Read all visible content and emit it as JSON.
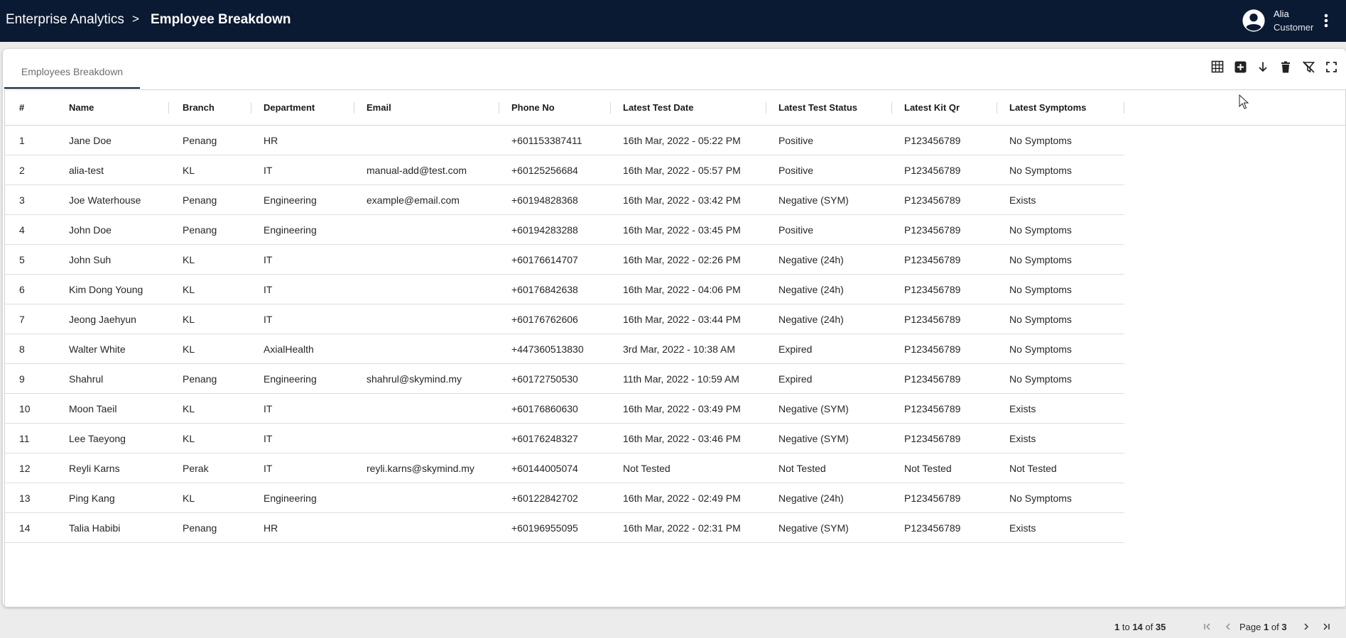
{
  "header": {
    "breadcrumb_root": "Enterprise Analytics",
    "breadcrumb_separator": ">",
    "page_title": "Employee Breakdown",
    "user": {
      "name": "Alia",
      "role": "Customer"
    }
  },
  "tabs": [
    {
      "label": "Employees Breakdown",
      "active": true
    }
  ],
  "toolbar": {
    "icons": [
      "table-grid-icon",
      "add-box-icon",
      "arrow-down-icon",
      "trash-icon",
      "clear-filter-icon",
      "fullscreen-icon"
    ]
  },
  "table": {
    "columns": [
      "#",
      "Name",
      "Branch",
      "Department",
      "Email",
      "Phone No",
      "Latest Test Date",
      "Latest Test Status",
      "Latest Kit Qr",
      "Latest Symptoms"
    ],
    "rows": [
      [
        "1",
        "Jane Doe",
        "Penang",
        "HR",
        "",
        "+601153387411",
        "16th Mar, 2022 - 05:22 PM",
        "Positive",
        "P123456789",
        "No Symptoms"
      ],
      [
        "2",
        "alia-test",
        "KL",
        "IT",
        "manual-add@test.com",
        "+60125256684",
        "16th Mar, 2022 - 05:57 PM",
        "Positive",
        "P123456789",
        "No Symptoms"
      ],
      [
        "3",
        "Joe Waterhouse",
        "Penang",
        "Engineering",
        "example@email.com",
        "+60194828368",
        "16th Mar, 2022 - 03:42 PM",
        "Negative (SYM)",
        "P123456789",
        "Exists"
      ],
      [
        "4",
        "John Doe",
        "Penang",
        "Engineering",
        "",
        "+60194283288",
        "16th Mar, 2022 - 03:45 PM",
        "Positive",
        "P123456789",
        "No Symptoms"
      ],
      [
        "5",
        "John Suh",
        "KL",
        "IT",
        "",
        "+60176614707",
        "16th Mar, 2022 - 02:26 PM",
        "Negative (24h)",
        "P123456789",
        "No Symptoms"
      ],
      [
        "6",
        "Kim Dong Young",
        "KL",
        "IT",
        "",
        "+60176842638",
        "16th Mar, 2022 - 04:06 PM",
        "Negative (24h)",
        "P123456789",
        "No Symptoms"
      ],
      [
        "7",
        "Jeong Jaehyun",
        "KL",
        "IT",
        "",
        "+60176762606",
        "16th Mar, 2022 - 03:44 PM",
        "Negative (24h)",
        "P123456789",
        "No Symptoms"
      ],
      [
        "8",
        "Walter White",
        "KL",
        "AxialHealth",
        "",
        "+447360513830",
        "3rd Mar, 2022 - 10:38 AM",
        "Expired",
        "P123456789",
        "No Symptoms"
      ],
      [
        "9",
        "Shahrul",
        "Penang",
        "Engineering",
        "shahrul@skymind.my",
        "+60172750530",
        "11th Mar, 2022 - 10:59 AM",
        "Expired",
        "P123456789",
        "No Symptoms"
      ],
      [
        "10",
        "Moon Taeil",
        "KL",
        "IT",
        "",
        "+60176860630",
        "16th Mar, 2022 - 03:49 PM",
        "Negative (SYM)",
        "P123456789",
        "Exists"
      ],
      [
        "11",
        "Lee Taeyong",
        "KL",
        "IT",
        "",
        "+60176248327",
        "16th Mar, 2022 - 03:46 PM",
        "Negative (SYM)",
        "P123456789",
        "Exists"
      ],
      [
        "12",
        "Reyli Karns",
        "Perak",
        "IT",
        "reyli.karns@skymind.my",
        "+60144005074",
        "Not Tested",
        "Not Tested",
        "Not Tested",
        "Not Tested"
      ],
      [
        "13",
        "Ping Kang",
        "KL",
        "Engineering",
        "",
        "+60122842702",
        "16th Mar, 2022 - 02:49 PM",
        "Negative (24h)",
        "P123456789",
        "No Symptoms"
      ],
      [
        "14",
        "Talia Habibi",
        "Penang",
        "HR",
        "",
        "+60196955095",
        "16th Mar, 2022 - 02:31 PM",
        "Negative (SYM)",
        "P123456789",
        "Exists"
      ]
    ]
  },
  "pagination": {
    "from": "1",
    "to_word": "to",
    "to": "14",
    "of_word": "of",
    "total": "35",
    "page_word": "Page",
    "page": "1",
    "pages": "3"
  }
}
